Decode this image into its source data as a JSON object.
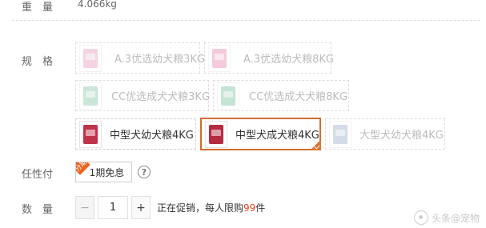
{
  "weight": {
    "label": "重　量",
    "value": "4.066kg"
  },
  "spec": {
    "label": "规　格",
    "options": [
      {
        "name": "A.3优选幼犬粮3KG",
        "state": "disabled",
        "bag_color": "#e8a0c4"
      },
      {
        "name": "A.3优选幼犬粮8KG",
        "state": "disabled",
        "bag_color": "#e88cb8"
      },
      {
        "name": "CC优选成犬犬粮3KG",
        "state": "disabled",
        "bag_color": "#8cc9a8"
      },
      {
        "name": "CC优选成犬犬粮8KG",
        "state": "disabled",
        "bag_color": "#7ec4a0"
      },
      {
        "name": "中型犬幼犬粮4KG",
        "state": "enabled",
        "bag_color": "#c0334a"
      },
      {
        "name": "中型犬成犬粮4KG",
        "state": "selected",
        "bag_color": "#b52b40"
      },
      {
        "name": "大型犬幼犬粮4KG",
        "state": "disabled",
        "bag_color": "#9fb3c8"
      }
    ]
  },
  "payment": {
    "label": "任性付",
    "tag": "分期",
    "option": "1期免息",
    "help": "?"
  },
  "quantity": {
    "label": "数　量",
    "minus": "−",
    "value": "1",
    "plus": "+",
    "promo_prefix": "正在促销，每人限购",
    "promo_limit": "99",
    "promo_suffix": "件"
  },
  "watermark": {
    "text": "头条@宠物"
  },
  "colors": {
    "accent": "#e4722c",
    "limit": "#e4441b",
    "border_selected": "#d46c2e"
  }
}
